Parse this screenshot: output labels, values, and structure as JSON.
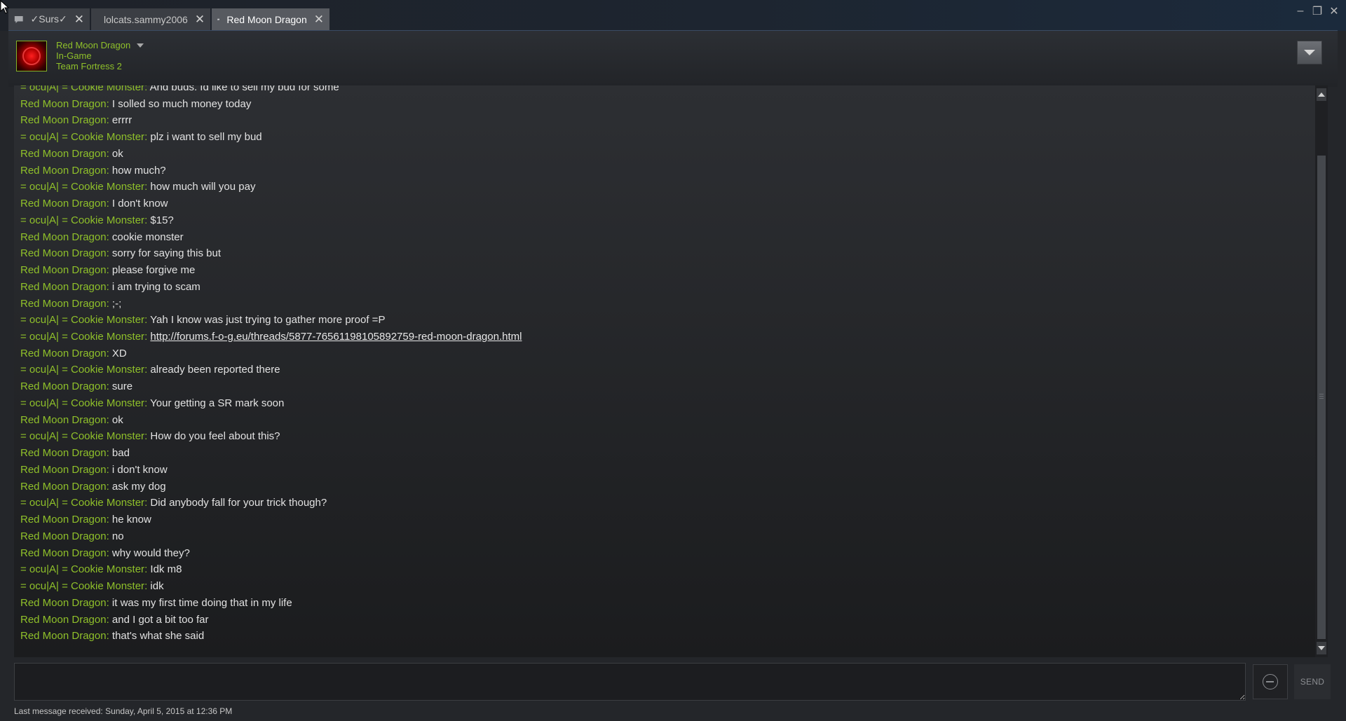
{
  "tabs": [
    {
      "label": "✓Surs✓",
      "icon": "chat-bubble-icon",
      "active": false
    },
    {
      "label": "lolcats.sammy2006",
      "icon": "chat-bubble-icon",
      "active": false
    },
    {
      "label": "Red Moon Dragon",
      "icon": "chat-bubble-icon",
      "active": true
    }
  ],
  "window_controls": {
    "minimize": "–",
    "restore": "❐",
    "close": "✕"
  },
  "friend": {
    "name": "Red Moon Dragon",
    "status": "In-Game",
    "game": "Team Fortress 2"
  },
  "messages": [
    {
      "sender": "= ocu|A| = Cookie Monster",
      "text": "And buds. Id like to sell my bud for some"
    },
    {
      "sender": "Red Moon Dragon",
      "text": "I solled so much money today"
    },
    {
      "sender": "Red Moon Dragon",
      "text": "errrr"
    },
    {
      "sender": "= ocu|A| = Cookie Monster",
      "text": "plz i want to sell my bud"
    },
    {
      "sender": "Red Moon Dragon",
      "text": "ok"
    },
    {
      "sender": "Red Moon Dragon",
      "text": "how much?"
    },
    {
      "sender": "= ocu|A| = Cookie Monster",
      "text": "how much will you pay"
    },
    {
      "sender": "Red Moon Dragon",
      "text": "I don't know"
    },
    {
      "sender": "= ocu|A| = Cookie Monster",
      "text": "$15?"
    },
    {
      "sender": "Red Moon Dragon",
      "text": "cookie monster"
    },
    {
      "sender": "Red Moon Dragon",
      "text": "sorry for saying this but"
    },
    {
      "sender": "Red Moon Dragon",
      "text": "please forgive me"
    },
    {
      "sender": "Red Moon Dragon",
      "text": "i am trying to scam"
    },
    {
      "sender": "Red Moon Dragon",
      "text": ";-;"
    },
    {
      "sender": "= ocu|A| = Cookie Monster",
      "text": "Yah I know was just trying to gather more proof =P"
    },
    {
      "sender": "= ocu|A| = Cookie Monster",
      "text": "http://forums.f-o-g.eu/threads/5877-76561198105892759-red-moon-dragon.html",
      "link": true
    },
    {
      "sender": "Red Moon Dragon",
      "text": "XD"
    },
    {
      "sender": "= ocu|A| = Cookie Monster",
      "text": "already been reported there"
    },
    {
      "sender": "Red Moon Dragon",
      "text": "sure"
    },
    {
      "sender": "= ocu|A| = Cookie Monster",
      "text": "Your getting a SR mark soon"
    },
    {
      "sender": "Red Moon Dragon",
      "text": "ok"
    },
    {
      "sender": "= ocu|A| = Cookie Monster",
      "text": "How do you feel about this?"
    },
    {
      "sender": "Red Moon Dragon",
      "text": "bad"
    },
    {
      "sender": "Red Moon Dragon",
      "text": "i don't know"
    },
    {
      "sender": "Red Moon Dragon",
      "text": "ask my dog"
    },
    {
      "sender": "= ocu|A| = Cookie Monster",
      "text": "Did anybody fall for your trick though?"
    },
    {
      "sender": "Red Moon Dragon",
      "text": "he know"
    },
    {
      "sender": "Red Moon Dragon",
      "text": "no"
    },
    {
      "sender": "Red Moon Dragon",
      "text": "why would they?"
    },
    {
      "sender": "= ocu|A| = Cookie Monster",
      "text": "Idk m8"
    },
    {
      "sender": "= ocu|A| = Cookie Monster",
      "text": "idk"
    },
    {
      "sender": "Red Moon Dragon",
      "text": "it was my first time doing that in my life"
    },
    {
      "sender": "Red Moon Dragon",
      "text": "and I got a bit too far"
    },
    {
      "sender": "Red Moon Dragon",
      "text": "that's what she said"
    }
  ],
  "composer": {
    "value": "",
    "placeholder": "",
    "send_label": "SEND"
  },
  "footer": {
    "last_message": "Last message received: Sunday, April 5, 2015 at 12:36 PM"
  },
  "colors": {
    "accent": "#8fc02a",
    "background": "#24262a",
    "text": "#e2e2e2"
  }
}
